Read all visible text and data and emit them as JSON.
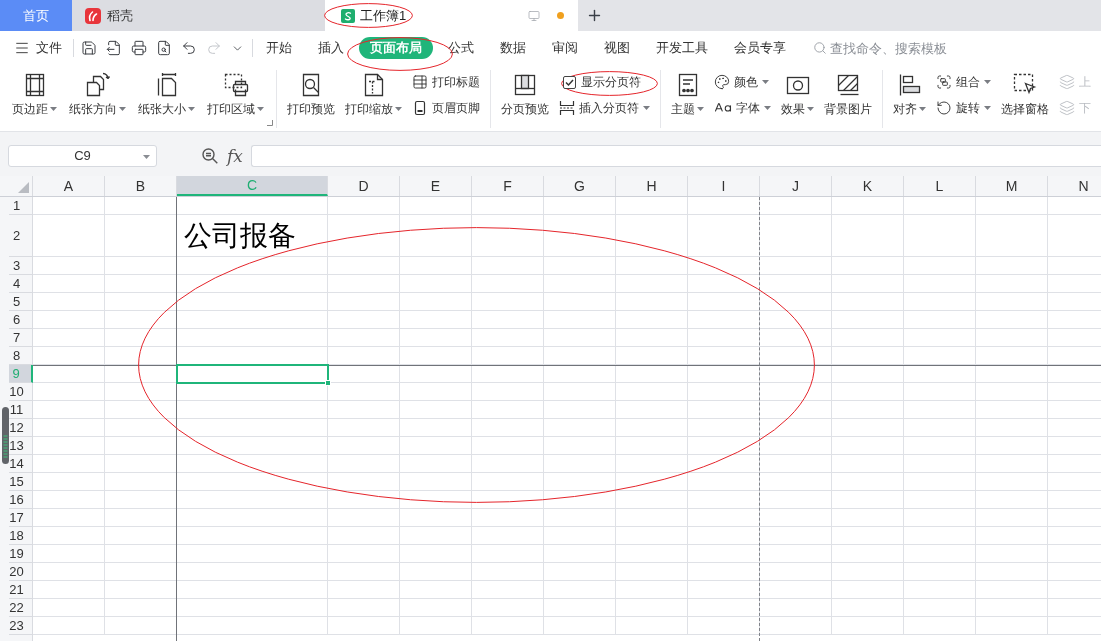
{
  "tabs": [
    {
      "kind": "home",
      "label": "首页",
      "selected": false,
      "unsaved": false
    },
    {
      "kind": "docer",
      "label": "稻壳",
      "selected": false,
      "unsaved": false
    },
    {
      "kind": "sheet",
      "label": "工作簿1",
      "selected": true,
      "unsaved": true
    }
  ],
  "toolbar": {
    "file_menu": "文件",
    "quick_access": [
      {
        "kind": "save",
        "disabled": false
      },
      {
        "kind": "export",
        "disabled": false
      },
      {
        "kind": "print",
        "disabled": false
      },
      {
        "kind": "preview",
        "disabled": false
      },
      {
        "kind": "undo",
        "disabled": false
      },
      {
        "kind": "redo",
        "disabled": true
      },
      {
        "kind": "more",
        "disabled": false
      }
    ],
    "tabs": [
      {
        "label": "开始",
        "selected": false
      },
      {
        "label": "插入",
        "selected": false
      },
      {
        "label": "页面布局",
        "selected": true
      },
      {
        "label": "公式",
        "selected": false
      },
      {
        "label": "数据",
        "selected": false
      },
      {
        "label": "审阅",
        "selected": false
      },
      {
        "label": "视图",
        "selected": false
      },
      {
        "label": "开发工具",
        "selected": false
      },
      {
        "label": "会员专享",
        "selected": false
      }
    ],
    "search": {
      "placeholder": "查找命令、搜索模板"
    }
  },
  "ribbon": {
    "groups": [
      {
        "dialog_launcher": true,
        "items": [
          {
            "kind": "large",
            "label": "页边距",
            "dropdown": true,
            "disabled": false
          },
          {
            "kind": "large",
            "label": "纸张方向",
            "dropdown": true,
            "disabled": false
          },
          {
            "kind": "large",
            "label": "纸张大小",
            "dropdown": true,
            "disabled": false
          },
          {
            "kind": "large",
            "label": "打印区域",
            "dropdown": true,
            "disabled": false
          }
        ]
      },
      {
        "items": [
          {
            "kind": "large",
            "label": "打印预览",
            "dropdown": false,
            "disabled": false
          },
          {
            "kind": "large",
            "label": "打印缩放",
            "dropdown": true,
            "disabled": false
          },
          {
            "kind": "stack",
            "items": [
              {
                "kind": "small",
                "label": "打印标题",
                "dropdown": false,
                "disabled": false
              },
              {
                "kind": "small",
                "label": "页眉页脚",
                "dropdown": false,
                "disabled": false
              }
            ]
          }
        ]
      },
      {
        "items": [
          {
            "kind": "large",
            "label": "分页预览",
            "dropdown": false,
            "disabled": false
          },
          {
            "kind": "stack",
            "items": [
              {
                "kind": "checkbox",
                "label": "显示分页符",
                "checked": true,
                "dropdown": false,
                "disabled": false
              },
              {
                "kind": "small",
                "label": "插入分页符",
                "dropdown": true,
                "disabled": false
              }
            ]
          }
        ]
      },
      {
        "items": [
          {
            "kind": "large",
            "label": "主题",
            "dropdown": true,
            "disabled": false
          },
          {
            "kind": "stack",
            "items": [
              {
                "kind": "small",
                "label": "颜色",
                "dropdown": true,
                "disabled": false
              },
              {
                "kind": "small",
                "label": "字体",
                "dropdown": true,
                "disabled": false
              }
            ]
          },
          {
            "kind": "large",
            "label": "效果",
            "dropdown": true,
            "disabled": false
          },
          {
            "kind": "large",
            "label": "背景图片",
            "dropdown": false,
            "disabled": false
          }
        ]
      },
      {
        "items": [
          {
            "kind": "large",
            "label": "对齐",
            "dropdown": true,
            "disabled": false
          },
          {
            "kind": "stack",
            "items": [
              {
                "kind": "small",
                "label": "组合",
                "dropdown": true,
                "disabled": false
              },
              {
                "kind": "small",
                "label": "旋转",
                "dropdown": true,
                "disabled": false
              }
            ]
          },
          {
            "kind": "large",
            "label": "选择窗格",
            "dropdown": false,
            "disabled": false
          },
          {
            "kind": "stack",
            "items": [
              {
                "kind": "small",
                "label": "上",
                "dropdown": false,
                "disabled": true
              },
              {
                "kind": "small",
                "label": "下",
                "dropdown": false,
                "disabled": true
              }
            ]
          }
        ]
      }
    ]
  },
  "formula_bar": {
    "name_box": "C9",
    "function_label": "fx"
  },
  "sheet": {
    "columns": [
      {
        "label": "A",
        "selected": false
      },
      {
        "label": "B",
        "selected": false
      },
      {
        "label": "C",
        "selected": true,
        "manual_page_break": true
      },
      {
        "label": "D",
        "selected": false
      },
      {
        "label": "E",
        "selected": false
      },
      {
        "label": "F",
        "selected": false
      },
      {
        "label": "G",
        "selected": false
      },
      {
        "label": "H",
        "selected": false
      },
      {
        "label": "I",
        "selected": false
      },
      {
        "label": "J",
        "selected": false,
        "auto_page_break": true
      },
      {
        "label": "K",
        "selected": false
      },
      {
        "label": "L",
        "selected": false
      },
      {
        "label": "M",
        "selected": false
      },
      {
        "label": "N",
        "selected": false
      }
    ],
    "rows": [
      {
        "label": "1",
        "selected": false
      },
      {
        "label": "2",
        "selected": false,
        "cells": [
          null,
          null,
          "公司报备"
        ]
      },
      {
        "label": "3",
        "selected": false
      },
      {
        "label": "4",
        "selected": false
      },
      {
        "label": "5",
        "selected": false
      },
      {
        "label": "6",
        "selected": false
      },
      {
        "label": "7",
        "selected": false
      },
      {
        "label": "8",
        "selected": false
      },
      {
        "label": "9",
        "selected": true,
        "manual_page_break": true
      },
      {
        "label": "10",
        "selected": false
      },
      {
        "label": "11",
        "selected": false
      },
      {
        "label": "12",
        "selected": false
      },
      {
        "label": "13",
        "selected": false
      },
      {
        "label": "14",
        "selected": false
      },
      {
        "label": "15",
        "selected": false
      },
      {
        "label": "16",
        "selected": false
      },
      {
        "label": "17",
        "selected": false
      },
      {
        "label": "18",
        "selected": false
      },
      {
        "label": "19",
        "selected": false
      },
      {
        "label": "20",
        "selected": false
      },
      {
        "label": "21",
        "selected": false
      },
      {
        "label": "22",
        "selected": false
      },
      {
        "label": "23",
        "selected": false
      }
    ]
  }
}
